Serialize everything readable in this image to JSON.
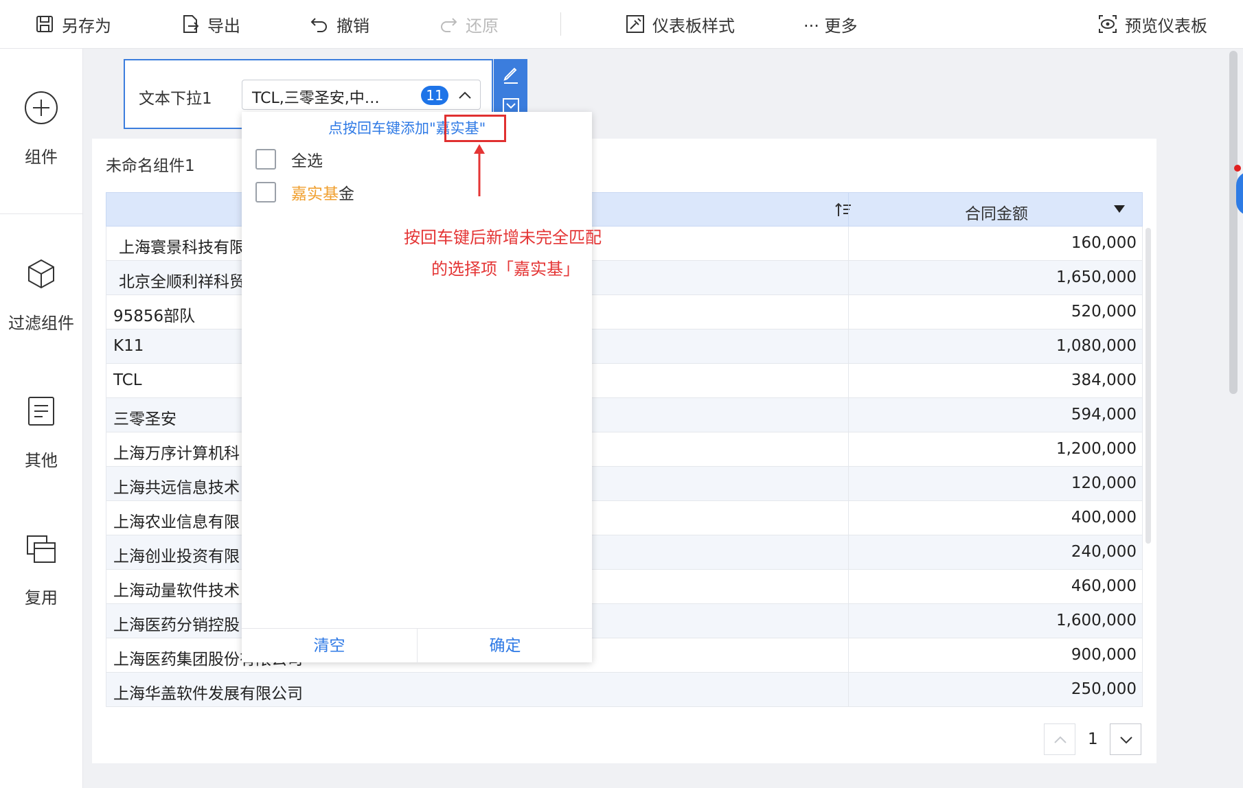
{
  "toolbar": {
    "save_as": "另存为",
    "export": "导出",
    "undo": "撤销",
    "redo": "还原",
    "dashboard_style": "仪表板样式",
    "more": "··· 更多",
    "preview": "预览仪表板"
  },
  "sidebar": {
    "items": [
      {
        "label": "组件",
        "icon": "plus-circle-icon"
      },
      {
        "label": "过滤组件",
        "icon": "cube-icon"
      },
      {
        "label": "其他",
        "icon": "document-icon"
      },
      {
        "label": "复用",
        "icon": "copy-icon"
      }
    ]
  },
  "filter": {
    "label": "文本下拉1",
    "selected_value": "TCL,三零圣安,中…",
    "selected_count": "11"
  },
  "dropdown": {
    "hint_prefix": "点按回车键添加",
    "hint_keyword": "\"嘉实基\"",
    "options": [
      {
        "label": "全选"
      },
      {
        "label_highlight": "嘉实基",
        "label_rest": "金"
      }
    ],
    "clear_label": "清空",
    "confirm_label": "确定"
  },
  "annotation": {
    "line1": "按回车键后新增未完全匹配",
    "line2": "的选择项「嘉实基」"
  },
  "widget": {
    "title": "未命名组件1",
    "amount_header": "合同金额",
    "rows": [
      {
        "name": "上海寰景科技有限",
        "amount": "160,000"
      },
      {
        "name": "北京全顺利祥科贸",
        "amount": "1,650,000"
      },
      {
        "name": "95856部队",
        "amount": "520,000"
      },
      {
        "name": "K11",
        "amount": "1,080,000"
      },
      {
        "name": "TCL",
        "amount": "384,000"
      },
      {
        "name": "三零圣安",
        "amount": "594,000"
      },
      {
        "name": "上海万序计算机科",
        "amount": "1,200,000"
      },
      {
        "name": "上海共远信息技术",
        "amount": "120,000"
      },
      {
        "name": "上海农业信息有限",
        "amount": "400,000"
      },
      {
        "name": "上海创业投资有限",
        "amount": "240,000"
      },
      {
        "name": "上海动量软件技术",
        "amount": "460,000"
      },
      {
        "name": "上海医药分销控股",
        "amount": "1,600,000"
      },
      {
        "name": "上海医药集团股份有限公司",
        "amount": "900,000"
      },
      {
        "name": "上海华盖软件发展有限公司",
        "amount": "250,000"
      }
    ]
  },
  "pager": {
    "current_page": "1"
  },
  "colors": {
    "accent": "#1e74e8",
    "header_bg": "#dbe7fb",
    "annotation_red": "#e43535",
    "highlight_orange": "#f0a030"
  }
}
